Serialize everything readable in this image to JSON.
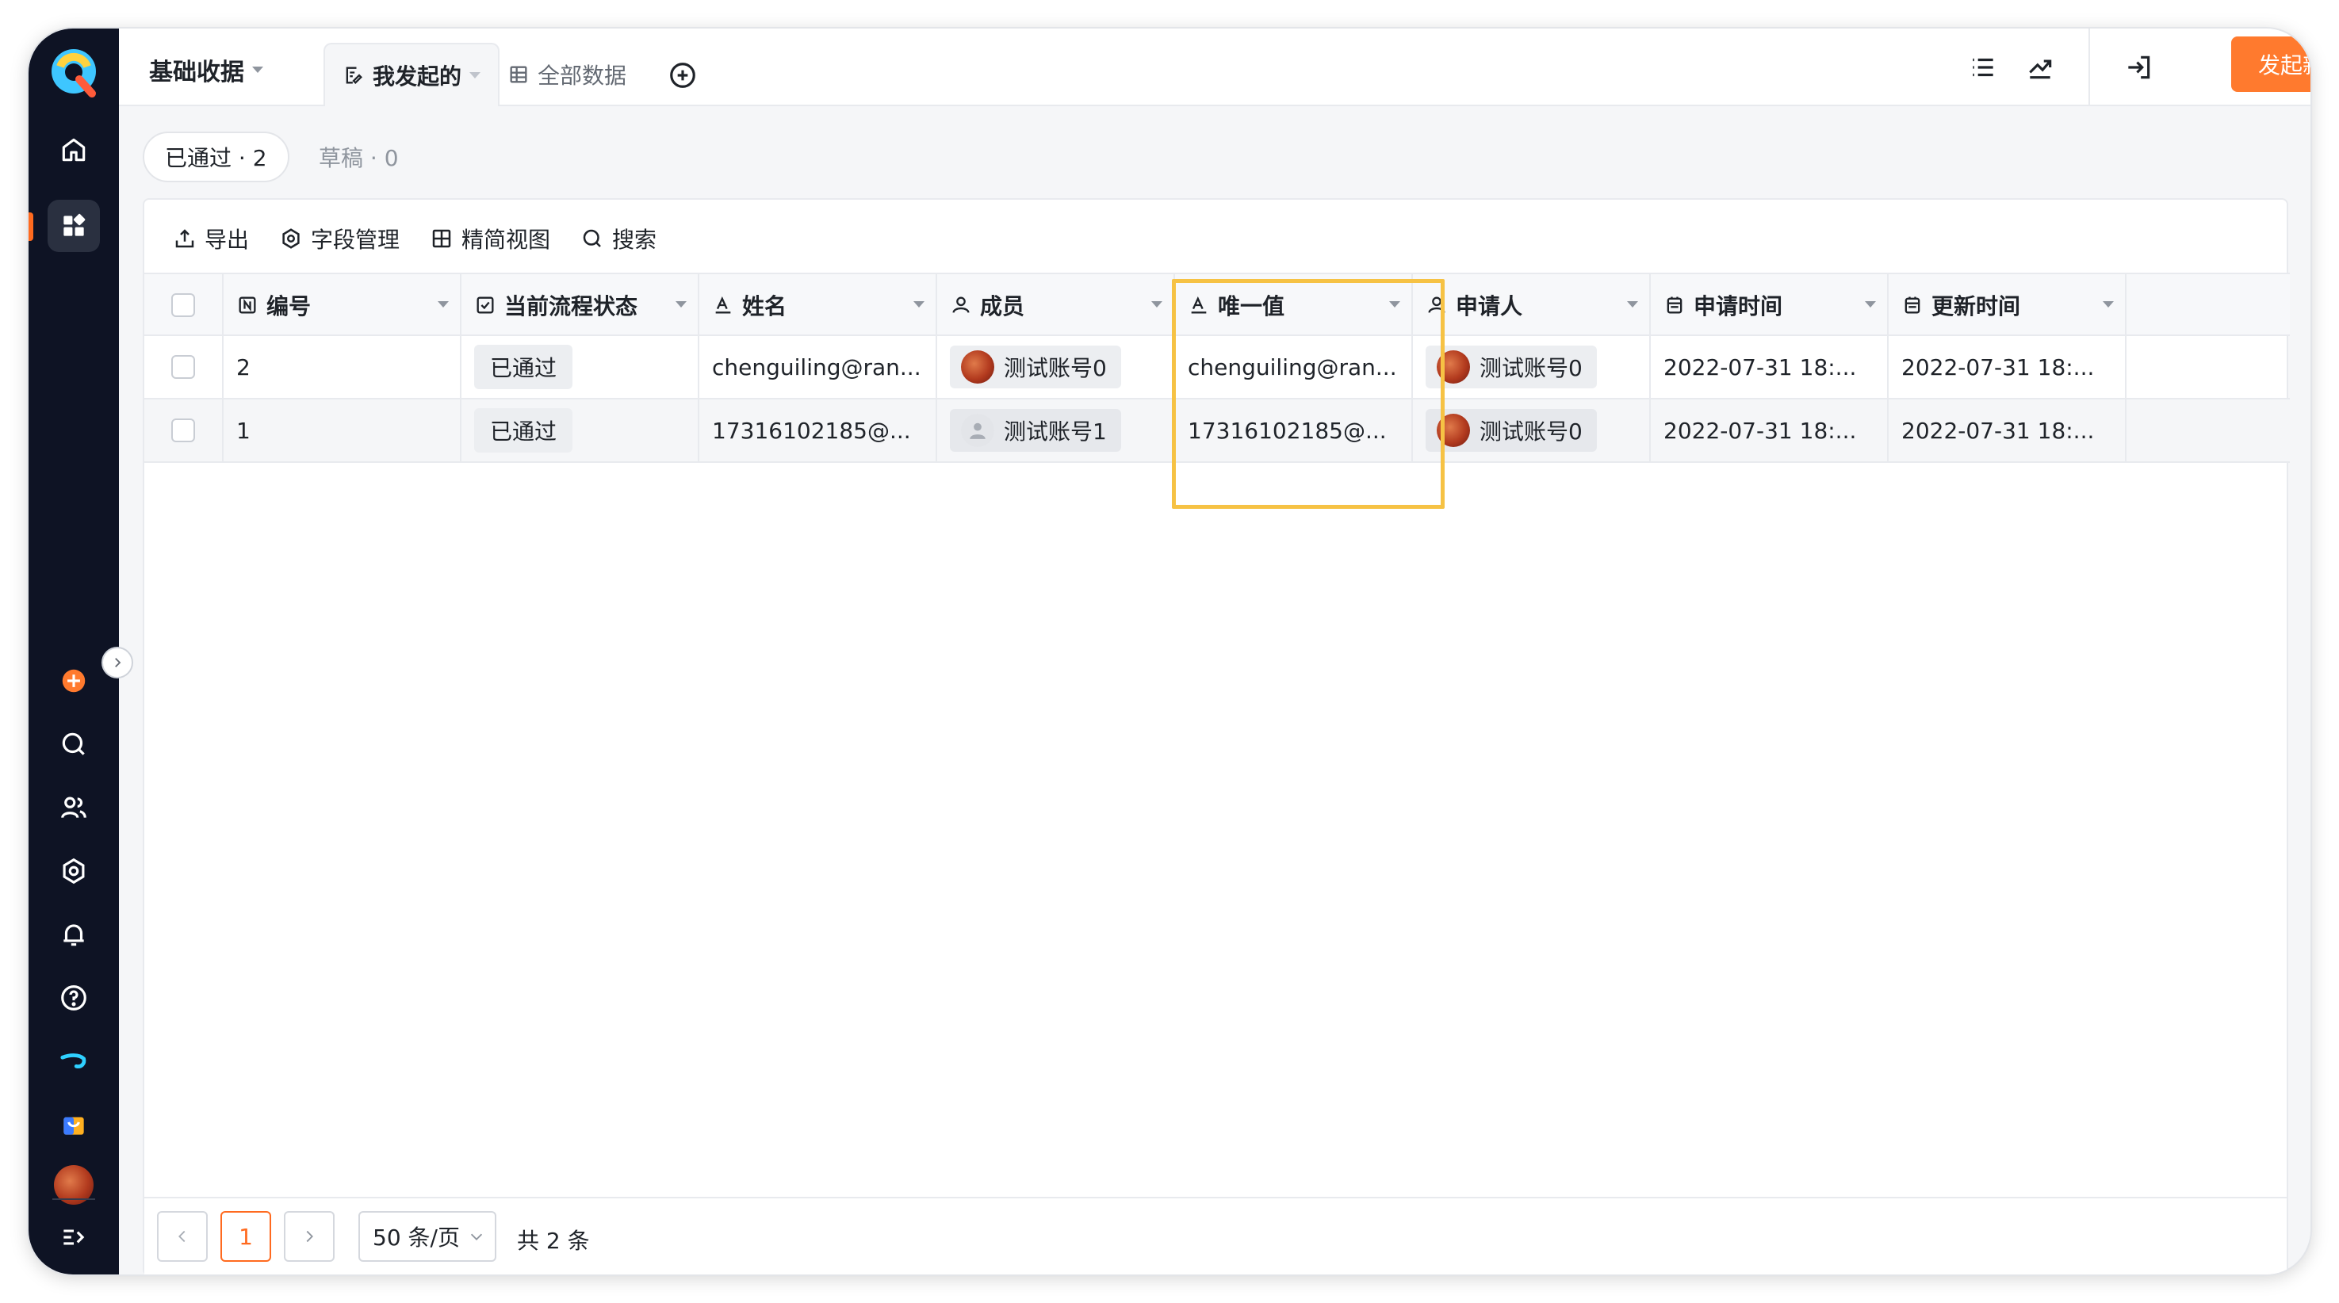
{
  "app": {
    "title": "基础收据"
  },
  "tabs": [
    {
      "label": "我发起的",
      "active": true
    },
    {
      "label": "全部数据",
      "active": false
    }
  ],
  "actions": {
    "start_new": "发起新的"
  },
  "filters": [
    {
      "label": "已通过 · 2",
      "active": true
    },
    {
      "label": "草稿 · 0",
      "active": false
    }
  ],
  "toolbar": {
    "export": "导出",
    "field_manage": "字段管理",
    "compact_view": "精简视图",
    "search": "搜索"
  },
  "table": {
    "columns": [
      "编号",
      "当前流程状态",
      "姓名",
      "成员",
      "唯一值",
      "申请人",
      "申请时间",
      "更新时间"
    ],
    "rows": [
      {
        "id": "2",
        "status": "已通过",
        "name": "chenguiling@ran...",
        "member": "测试账号0",
        "unique": "chenguiling@ran...",
        "applicant": "测试账号0",
        "apply_time": "2022-07-31 18:...",
        "update_time": "2022-07-31 18:..."
      },
      {
        "id": "1",
        "status": "已通过",
        "name": "17316102185@...",
        "member": "测试账号1",
        "unique": "17316102185@...",
        "applicant": "测试账号0",
        "apply_time": "2022-07-31 18:...",
        "update_time": "2022-07-31 18:..."
      }
    ]
  },
  "pagination": {
    "current_page": "1",
    "page_size": "50 条/页",
    "total": "共 2 条"
  },
  "colors": {
    "accent": "#ff7a2e",
    "sidebar_bg": "#0e1324",
    "highlight": "#f6c244"
  }
}
